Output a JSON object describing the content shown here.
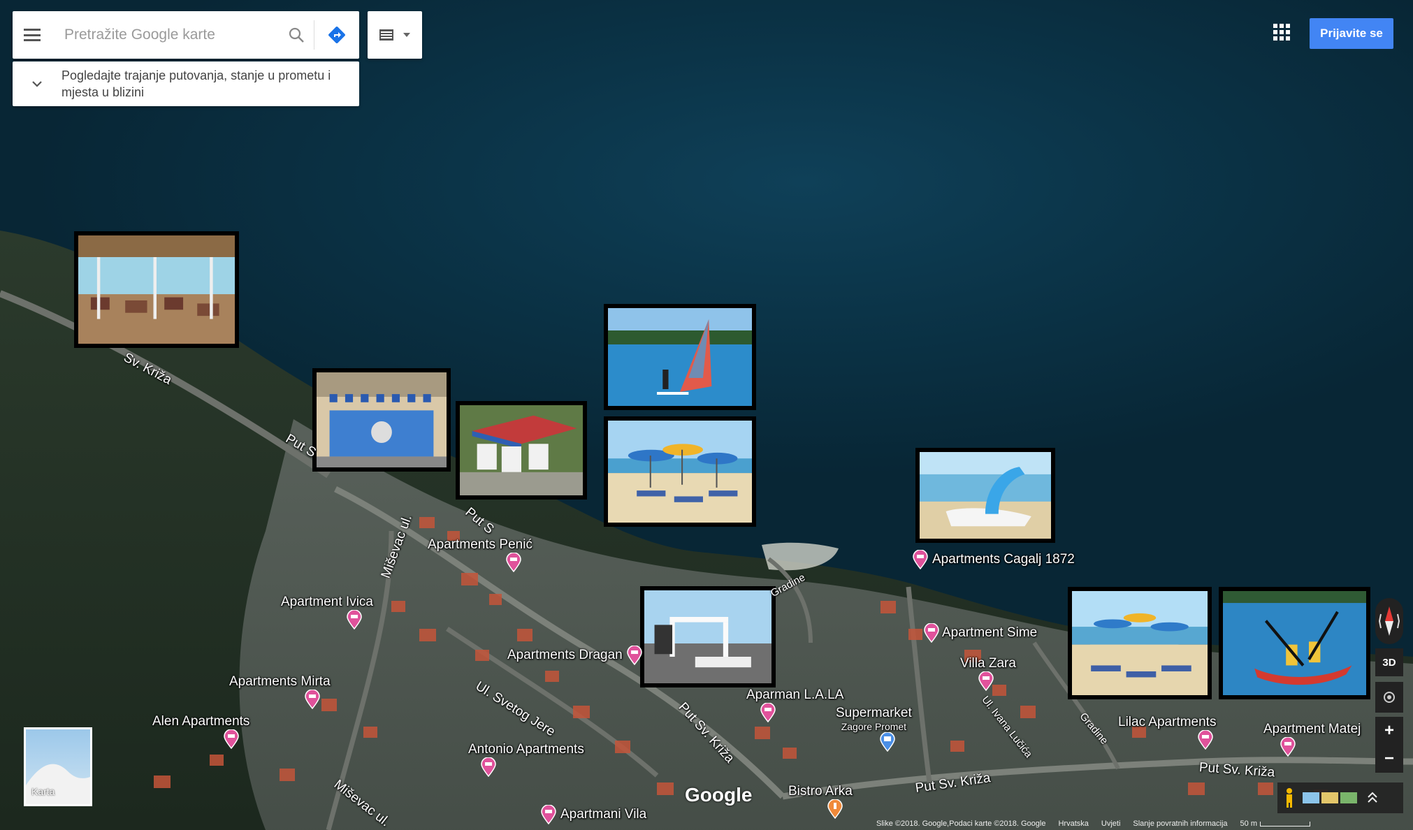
{
  "search": {
    "placeholder": "Pretražite Google karte"
  },
  "trip_info": {
    "text": "Pogledajte trajanje putovanja, stanje u prometu i mjesta u blizini"
  },
  "header": {
    "signin_label": "Prijavite se"
  },
  "pois": [
    {
      "name": "Apartments Penić"
    },
    {
      "name": "Apartment Ivica"
    },
    {
      "name": "Apartments Mirta"
    },
    {
      "name": "Alen Apartments"
    },
    {
      "name": "Antonio Apartments"
    },
    {
      "name": "Apartmani Vila"
    },
    {
      "name": "Apartments Dragan"
    },
    {
      "name": "Aparman L.A.LA"
    },
    {
      "name": "Supermarket"
    },
    {
      "name": "Zagore Promet"
    },
    {
      "name": "Bistro Arka"
    },
    {
      "name": "Apartments Cagalj 1872"
    },
    {
      "name": "Apartment Sime"
    },
    {
      "name": "Villa Zara"
    },
    {
      "name": "Lilac Apartments"
    },
    {
      "name": "Apartment Matej"
    }
  ],
  "roads": [
    {
      "name": "Sv. Križa"
    },
    {
      "name": "Put S"
    },
    {
      "name": "Put S"
    },
    {
      "name": "Miševac ul."
    },
    {
      "name": "Ul. Svetog Jere"
    },
    {
      "name": "Put Sv. Križa"
    },
    {
      "name": "Miševac ul."
    },
    {
      "name": "Gradine"
    },
    {
      "name": "Ul. Ivana Lučića"
    },
    {
      "name": "Gradine"
    },
    {
      "name": "Put Sv. Križa"
    },
    {
      "name": "Put Sv. Križa"
    }
  ],
  "controls": {
    "three_d": "3D",
    "zoom_in": "+",
    "zoom_out": "−"
  },
  "minimap": {
    "label": "Karta"
  },
  "logo": "Google",
  "footer": {
    "imagery": "Slike ©2018. Google,Podaci karte ©2018. Google",
    "language": "Hrvatska",
    "terms": "Uvjeti",
    "feedback": "Slanje povratnih informacija",
    "scale": "50 m"
  },
  "colors": {
    "accent": "#4285f4",
    "pin": "#e0529b",
    "sea": "#0b3448"
  }
}
